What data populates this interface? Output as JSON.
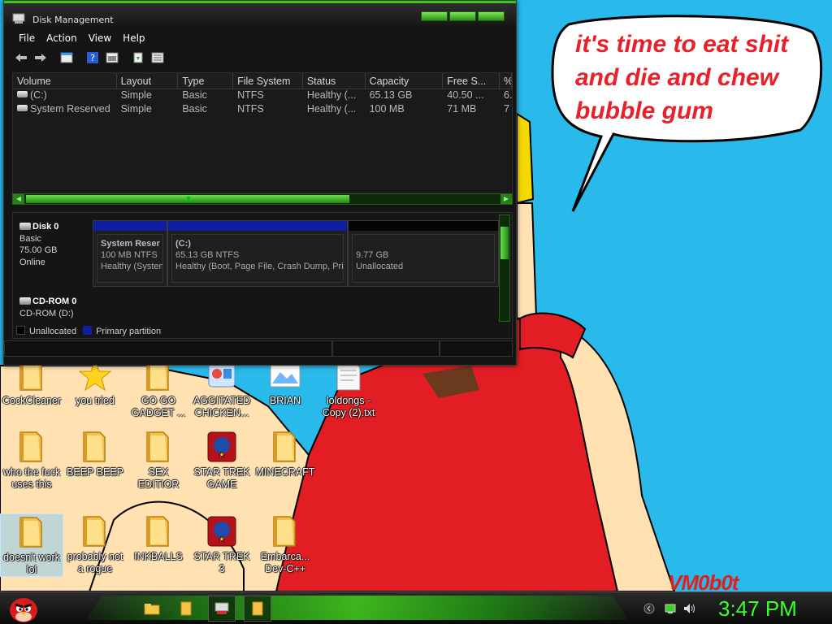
{
  "wallpaper": {
    "speech_text": "it's time to eat shit and die and chew bubble gum",
    "signature": "VM0b0t",
    "colors": {
      "sky": "#29b9ea",
      "shirt": "#e21d23",
      "skin": "#ffe1b2",
      "text": "#e8202a"
    }
  },
  "window": {
    "title": "Disk Management",
    "accent": "#3ec41e",
    "menu": [
      "File",
      "Action",
      "View",
      "Help"
    ],
    "toolbar_icons": [
      "back-arrow-icon",
      "forward-arrow-icon",
      "properties-icon",
      "help-icon",
      "console-icon",
      "refresh-icon",
      "rescan-icon"
    ],
    "volumes": {
      "columns": [
        "Volume",
        "Layout",
        "Type",
        "File System",
        "Status",
        "Capacity",
        "Free S...",
        "%"
      ],
      "rows": [
        {
          "volume": "(C:)",
          "layout": "Simple",
          "type": "Basic",
          "fs": "NTFS",
          "status": "Healthy (...",
          "capacity": "65.13 GB",
          "free": "40.50 ...",
          "pct": "6."
        },
        {
          "volume": "System Reserved",
          "layout": "Simple",
          "type": "Basic",
          "fs": "NTFS",
          "status": "Healthy (...",
          "capacity": "100 MB",
          "free": "71 MB",
          "pct": "7"
        }
      ]
    },
    "disks": [
      {
        "name": "Disk 0",
        "lines": [
          "Basic",
          "75.00 GB",
          "Online"
        ],
        "partitions": [
          {
            "name": "System Reser",
            "size": "100 MB NTFS",
            "status": "Healthy (Systen",
            "kind": "primary"
          },
          {
            "name": "(C:)",
            "size": "65.13 GB NTFS",
            "status": "Healthy (Boot, Page File, Crash Dump, Prim",
            "kind": "primary"
          },
          {
            "name": "",
            "size": "9.77 GB",
            "status": "Unallocated",
            "kind": "unallocated"
          }
        ]
      },
      {
        "name": "CD-ROM 0",
        "lines": [
          "CD-ROM (D:)"
        ]
      }
    ],
    "legend": [
      {
        "label": "Unallocated",
        "color": "#000000"
      },
      {
        "label": "Primary partition",
        "color": "#0f1e9e"
      }
    ]
  },
  "desktop_icons": [
    {
      "label": "CockCleaner",
      "icon": "folder-icon"
    },
    {
      "label": "you tried",
      "icon": "star-icon"
    },
    {
      "label": "GO GO GADGET ...",
      "icon": "folder-icon"
    },
    {
      "label": "AGGITATED CHICKEN...",
      "icon": "app-icon"
    },
    {
      "label": "BRIAN",
      "icon": "image-icon"
    },
    {
      "label": "loldongs - Copy (2).txt",
      "icon": "text-file-icon"
    },
    {
      "label": "who the fuck uses this",
      "icon": "folder-icon"
    },
    {
      "label": "BEEP BEEP",
      "icon": "folder-icon"
    },
    {
      "label": "SEX EDITIOR",
      "icon": "folder-icon"
    },
    {
      "label": "STAR TREK GAME",
      "icon": "game-icon"
    },
    {
      "label": "MINECRAFT",
      "icon": "folder-icon"
    },
    {
      "label": "doesn't work lol",
      "icon": "folder-icon"
    },
    {
      "label": "probably not a rogue",
      "icon": "folder-icon"
    },
    {
      "label": "INKBALLS",
      "icon": "folder-icon"
    },
    {
      "label": "STAR TREK 3",
      "icon": "game-icon"
    },
    {
      "label": "Embarca... Dev-C++",
      "icon": "folder-icon"
    }
  ],
  "taskbar": {
    "clock": "3:47 PM",
    "items": [
      "explorer-icon",
      "folder-icon",
      "disk-management-icon",
      "folder-icon"
    ],
    "tray": [
      "show-hidden-icon",
      "network-icon",
      "volume-icon"
    ]
  }
}
